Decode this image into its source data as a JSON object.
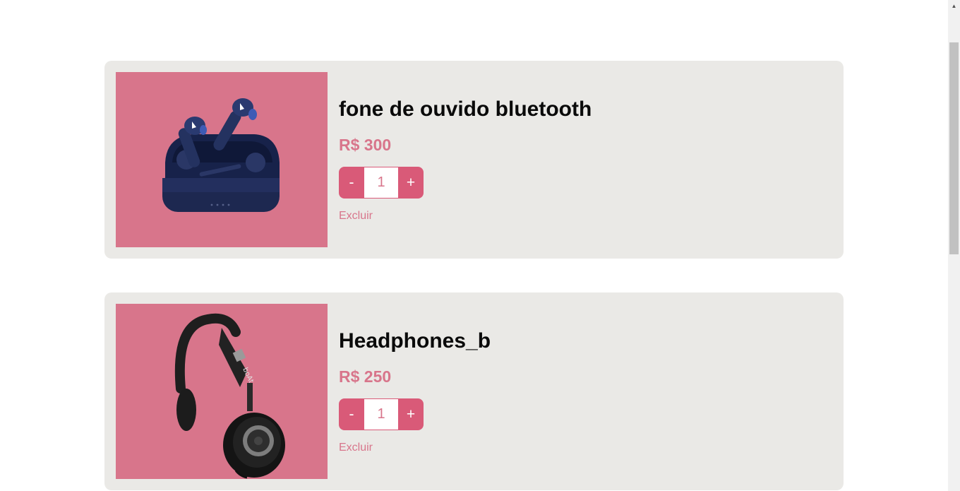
{
  "cart": {
    "items": [
      {
        "name": "fone de ouvido bluetooth",
        "price": "R$ 300",
        "quantity": "1",
        "minus_label": "-",
        "plus_label": "+",
        "remove_label": "Excluir",
        "image_bg": "#d8758b"
      },
      {
        "name": "Headphones_b",
        "price": "R$ 250",
        "quantity": "1",
        "minus_label": "-",
        "plus_label": "+",
        "remove_label": "Excluir",
        "image_bg": "#d8758b"
      }
    ]
  },
  "colors": {
    "card_bg": "#eae9e6",
    "accent": "#d95a78",
    "price_text": "#d8758b"
  }
}
